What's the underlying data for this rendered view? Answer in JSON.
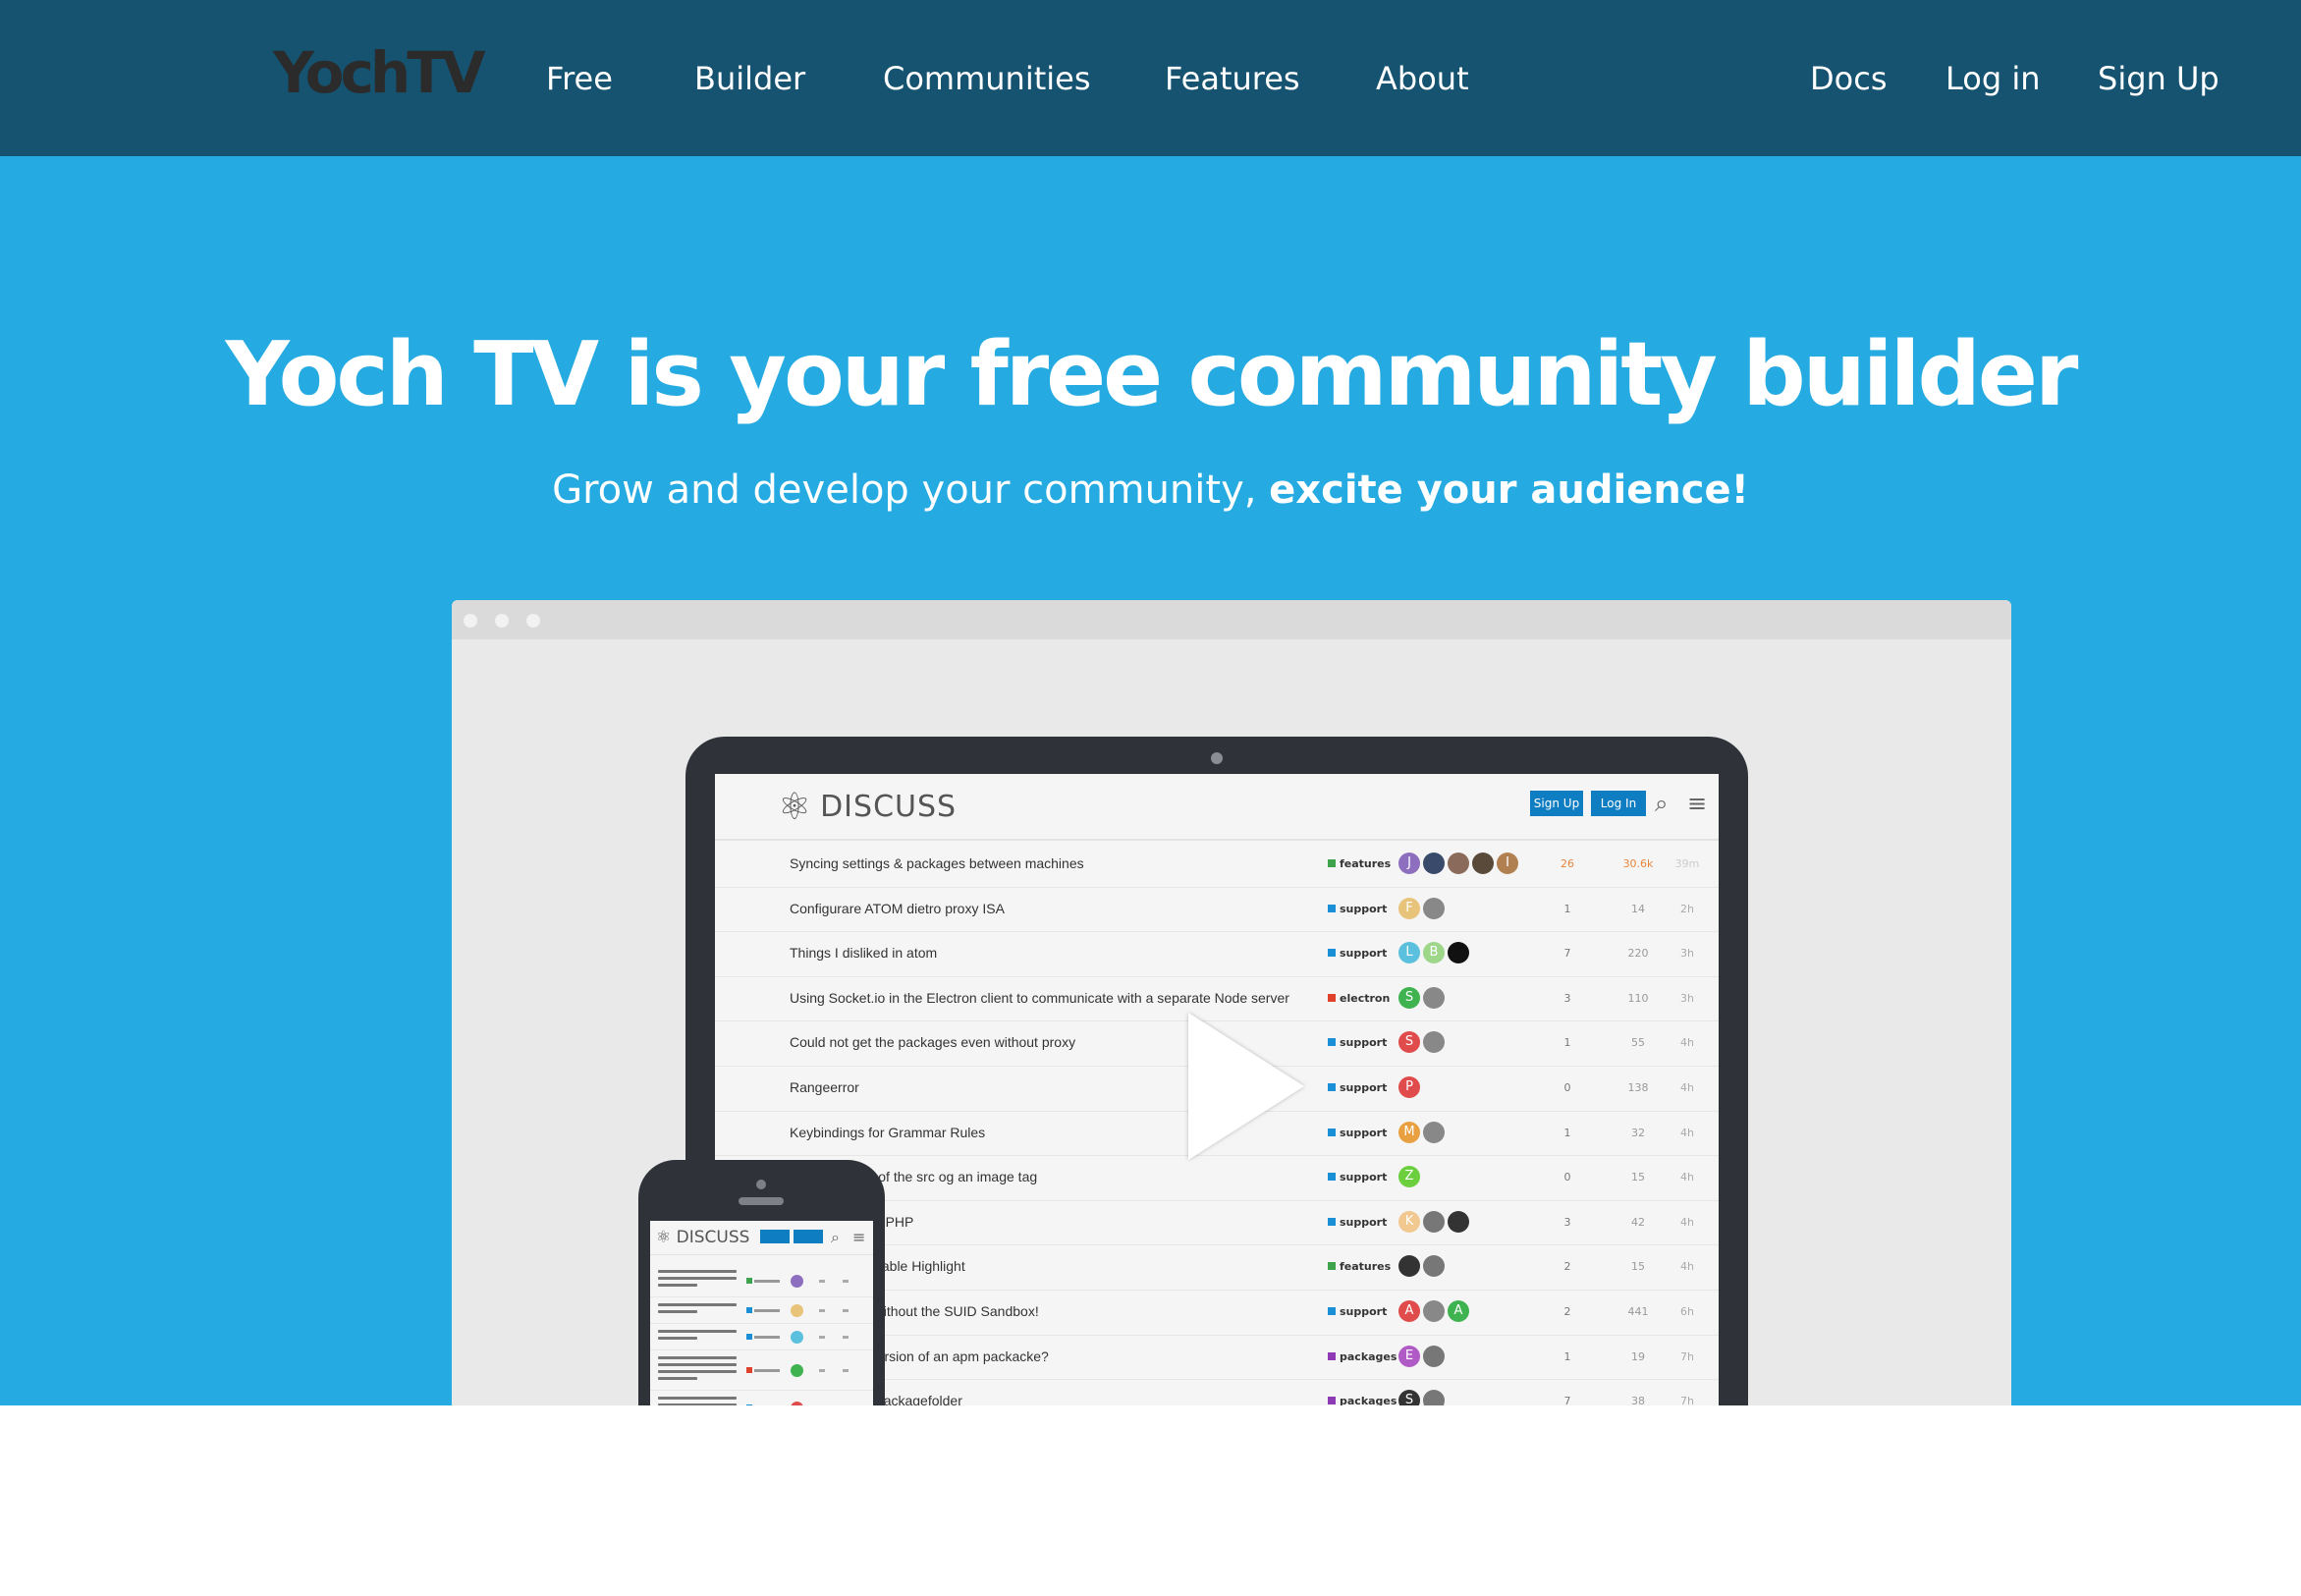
{
  "nav": {
    "logo": "YochTV",
    "links": [
      "Free",
      "Builder",
      "Communities",
      "Features",
      "About"
    ],
    "right_links": [
      "Docs",
      "Log in",
      "Sign Up"
    ]
  },
  "hero": {
    "title": "Yoch TV is your free community builder",
    "subtitle_plain": "Grow and develop your community, ",
    "subtitle_bold": "excite your audience!"
  },
  "video": {
    "brand": "DISCUSS",
    "signup_label": "Sign Up",
    "login_label": "Log In",
    "icons": [
      "atom-icon",
      "search-icon",
      "menu-icon",
      "play-icon"
    ],
    "topics": [
      {
        "title": "Syncing settings & packages between machines",
        "category": "features",
        "cat_color": "#3fa34d",
        "avatars": [
          {
            "l": "J",
            "c": "#8e6fbf"
          },
          {
            "l": "",
            "c": "#3a4a6b"
          },
          {
            "l": "",
            "c": "#8a6a5a"
          },
          {
            "l": "",
            "c": "#5a4a3a"
          },
          {
            "l": "I",
            "c": "#b08050"
          }
        ],
        "replies": "26",
        "views": "30.6k",
        "activity": "39m",
        "hot": true
      },
      {
        "title": "Configurare ATOM dietro proxy ISA",
        "category": "support",
        "cat_color": "#1a8fd6",
        "avatars": [
          {
            "l": "F",
            "c": "#e8c37a"
          },
          {
            "l": "",
            "c": "#888"
          }
        ],
        "replies": "1",
        "views": "14",
        "activity": "2h"
      },
      {
        "title": "Things I disliked in atom",
        "category": "support",
        "cat_color": "#1a8fd6",
        "avatars": [
          {
            "l": "L",
            "c": "#5bc0de"
          },
          {
            "l": "B",
            "c": "#9ed68a"
          },
          {
            "l": "",
            "c": "#111"
          }
        ],
        "replies": "7",
        "views": "220",
        "activity": "3h"
      },
      {
        "title": "Using Socket.io in the Electron client to communicate with a separate Node server",
        "category": "electron",
        "cat_color": "#e0412b",
        "avatars": [
          {
            "l": "S",
            "c": "#3fb34f"
          },
          {
            "l": "",
            "c": "#888"
          }
        ],
        "replies": "3",
        "views": "110",
        "activity": "3h"
      },
      {
        "title": "Could not get the packages even without proxy",
        "category": "support",
        "cat_color": "#1a8fd6",
        "avatars": [
          {
            "l": "S",
            "c": "#e04b4b"
          },
          {
            "l": "",
            "c": "#888"
          }
        ],
        "replies": "1",
        "views": "55",
        "activity": "4h"
      },
      {
        "title": "Rangeerror",
        "category": "support",
        "cat_color": "#1a8fd6",
        "avatars": [
          {
            "l": "P",
            "c": "#e04b4b"
          }
        ],
        "replies": "0",
        "views": "138",
        "activity": "4h"
      },
      {
        "title": "Keybindings for Grammar Rules",
        "category": "support",
        "cat_color": "#1a8fd6",
        "avatars": [
          {
            "l": "M",
            "c": "#e8a040"
          },
          {
            "l": "",
            "c": "#888"
          }
        ],
        "replies": "1",
        "views": "32",
        "activity": "4h"
      },
      {
        "title": "How to put url of the src og an image tag",
        "category": "support",
        "cat_color": "#1a8fd6",
        "avatars": [
          {
            "l": "Z",
            "c": "#6ccf3e"
          }
        ],
        "replies": "0",
        "views": "15",
        "activity": "4h"
      },
      {
        "title": "Can't comment PHP",
        "category": "support",
        "cat_color": "#1a8fd6",
        "avatars": [
          {
            "l": "K",
            "c": "#f0c890"
          },
          {
            "l": "",
            "c": "#777"
          },
          {
            "l": "",
            "c": "#333"
          }
        ],
        "replies": "3",
        "views": "42",
        "activity": "4h"
      },
      {
        "title": "Customize Variable Highlight",
        "category": "features",
        "cat_color": "#3fa34d",
        "avatars": [
          {
            "l": "",
            "c": "#333"
          },
          {
            "l": "",
            "c": "#777"
          }
        ],
        "replies": "2",
        "views": "15",
        "activity": "4h"
      },
      {
        "title": "Launch Atom without the SUID Sandbox!",
        "category": "support",
        "cat_color": "#1a8fd6",
        "avatars": [
          {
            "l": "A",
            "c": "#e04b4b"
          },
          {
            "l": "",
            "c": "#888"
          },
          {
            "l": "A",
            "c": "#3fb34f"
          }
        ],
        "replies": "2",
        "views": "441",
        "activity": "6h"
      },
      {
        "title": "Installing old version of an apm packacke?",
        "category": "packages",
        "cat_color": "#8e3ab5",
        "avatars": [
          {
            "l": "E",
            "c": "#b05bc5"
          },
          {
            "l": "",
            "c": "#777"
          }
        ],
        "replies": "1",
        "views": "19",
        "activity": "7h"
      },
      {
        "title": "Remove from packagefolder",
        "category": "packages",
        "cat_color": "#8e3ab5",
        "avatars": [
          {
            "l": "S",
            "c": "#333"
          },
          {
            "l": "",
            "c": "#777"
          }
        ],
        "replies": "7",
        "views": "38",
        "activity": "7h"
      }
    ]
  },
  "colors": {
    "nav_bg": "#155370",
    "hero_bg": "#25aae1",
    "logo": "#2b2b2b"
  }
}
